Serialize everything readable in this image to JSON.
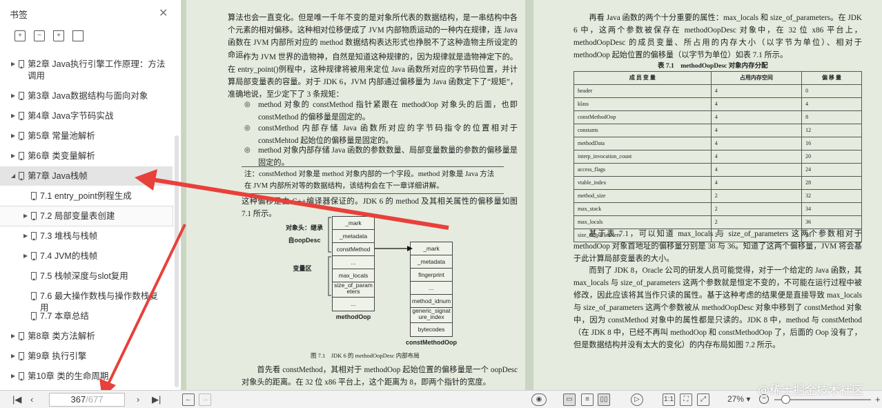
{
  "sidebar": {
    "title": "书签",
    "toolbar_icons": [
      "expand-all-icon",
      "collapse-all-icon",
      "add-bookmark-icon",
      "bookmark-icon"
    ],
    "items": [
      {
        "label": "第2章 Java执行引擎工作原理：方法调用",
        "level": 0,
        "toggle": "▶"
      },
      {
        "label": "第3章 Java数据结构与面向对象",
        "level": 0,
        "toggle": "▶"
      },
      {
        "label": "第4章 Java字节码实战",
        "level": 0,
        "toggle": "▶"
      },
      {
        "label": "第5章 常量池解析",
        "level": 0,
        "toggle": "▶"
      },
      {
        "label": "第6章 类变量解析",
        "level": 0,
        "toggle": "▶"
      },
      {
        "label": "第7章 Java栈帧",
        "level": 0,
        "toggle": "◢"
      },
      {
        "label": "7.1 entry_point例程生成",
        "level": 1,
        "toggle": ""
      },
      {
        "label": "7.2 局部变量表创建",
        "level": 1,
        "toggle": "▶"
      },
      {
        "label": "7.3 堆栈与栈帧",
        "level": 1,
        "toggle": "▶"
      },
      {
        "label": "7.4 JVM的栈帧",
        "level": 1,
        "toggle": "▶"
      },
      {
        "label": "7.5 栈帧深度与slot复用",
        "level": 1,
        "toggle": ""
      },
      {
        "label": "7.6 最大操作数栈与操作数栈复用",
        "level": 1,
        "toggle": ""
      },
      {
        "label": "7.7 本章总结",
        "level": 1,
        "toggle": ""
      },
      {
        "label": "第8章 类方法解析",
        "level": 0,
        "toggle": "▶"
      },
      {
        "label": "第9章 执行引擎",
        "level": 0,
        "toggle": "▶"
      },
      {
        "label": "第10章 类的生命周期",
        "level": 0,
        "toggle": "▶"
      }
    ]
  },
  "page_left": {
    "p1": "算法也会一直变化。但是唯一千年不变的是对象所代表的数据结构，是一串结构中各个元素的相对偏移。这种相对位移便成了 JVM 内部物质运动的一种内在规律，连 Java 函数在 JVM 内部所对应的 method 数据结构表达形式也挣脱不了这种造物主所设定的命运。",
    "p2": "作为 JVM 世界的造物神，自然是知道这种规律的，因为规律就是造物神定下的。在 entry_point()例程中，这种规律将被用来定位 Java 函数所对应的字节码位置，并计算局部变量表的容量。对于 JDK 6，JVM 内部通过偏移量为 Java 函数定下了“规矩”，准确地说，至少定下了 3 条规矩：",
    "b1": "method 对象的 constMethod 指针紧跟在 methodOop 对象头的后面，也即 constMethod 的偏移量是固定的。",
    "b2": "constMethod 内部存储 Java 函数所对应的字节码指令的位置相对于 constMehtod 起始位的偏移量是固定的。",
    "b3": "method 对象内部存储 Java 函数的参数数量、局部变量数量的参数的偏移量是固定的。",
    "note": "注：constMethod 对象是 method 对象内部的一个字段。method 对象是 Java 方法在 JVM 内部所对等的数据结构，该结构会在下一章详细讲解。",
    "p3": "这种偏移是由 C++编译器保证的。JDK 6 的 method 及其相关属性的偏移量如图 7.1 所示。",
    "fig_caption": "图 7.1　JDK 6 的 methodOopDesc 内部布局",
    "p4": "首先看 constMethod，其相对于 methodOop 起始位置的偏移量是一个 oopDesc 对象头的距离。在 32 位 x86 平台上，这个距离为 8，即两个指针的宽度。"
  },
  "figure": {
    "label_header": "对象头：继承自oopDesc",
    "label_vars": "变量区",
    "methodOop_rows": [
      "_mark",
      "_metadata",
      "constMethod",
      "...",
      "max_locals",
      "size_of_parameters",
      "..."
    ],
    "methodOop_title": "methodOop",
    "constMethod_rows": [
      "_mark",
      "_metadata",
      "fingerprint",
      "...",
      "method_idnum",
      "generic_signature_index",
      "bytecodes"
    ],
    "constMethod_title": "constMethodOop"
  },
  "page_right": {
    "p1": "再看 Java 函数的两个十分重要的属性：max_locals 和 size_of_parameters。在 JDK 6 中，这两个参数被保存在 methodOopDesc 对象中，在 32 位 x86 平台上，methodOopDesc 的成员变量、所占用的内存大小（以字节为单位）、相对于 methodOop 起始位置的偏移量（以字节为单位）如表 7.1 所示。",
    "table_title": "表 7.1　methodOopDesc 对象内存分配",
    "table_headers": [
      "成 员 变 量",
      "占用内存空间",
      "偏 移 量"
    ],
    "table_rows": [
      [
        "header",
        "4",
        "0"
      ],
      [
        "klass",
        "4",
        "4"
      ],
      [
        "constMethodOop",
        "4",
        "8"
      ],
      [
        "constants",
        "4",
        "12"
      ],
      [
        "methodData",
        "4",
        "16"
      ],
      [
        "interp_invocation_count",
        "4",
        "20"
      ],
      [
        "access_flags",
        "4",
        "24"
      ],
      [
        "vtable_index",
        "4",
        "28"
      ],
      [
        "method_size",
        "2",
        "32"
      ],
      [
        "max_stack",
        "2",
        "34"
      ],
      [
        "max_locals",
        "2",
        "36"
      ],
      [
        "size_of_parameters",
        "2",
        "38"
      ]
    ],
    "p2": "基于表 7.1，可以知道 max_locals 与 size_of_parameters 这两个参数相对于 methodOop 对象首地址的偏移量分别是 38 与 36。知道了这两个偏移量，JVM 将会基于此计算局部变量表的大小。",
    "p3": "而到了 JDK 8，Oracle 公司的研发人员可能觉得，对于一个给定的 Java 函数，其 max_locals 与 size_of_parameters 这两个参数就是恒定不变的，不可能在运行过程中被修改，因此应该将其当作只读的属性。基于这种考虑的结果便是直接导致 max_locals 与 size_of_parameters 这两个参数被从 methodOopDesc 对象中移到了 constMethod 对象中，因为 constMethod 对象中的属性都是只读的。JDK 8 中，method 与 constMethod（在 JDK 8 中，已经不再叫 methodOop 和 constMethodOop 了，后面的 Oop 没有了，但是数据结构并没有太大的变化）的内存布局如图 7.2 所示。"
  },
  "statusbar": {
    "current_page": "367",
    "total_pages": "/677",
    "zoom": "27%",
    "first_icon": "first-page-icon",
    "prev_icon": "prev-page-icon",
    "next_icon": "next-page-icon",
    "last_icon": "last-page-icon"
  },
  "watermark": "@稀土掘金技术社区",
  "colors": {
    "page_bg": "#e5ebde",
    "doc_bg": "#c9d6c1",
    "arrow": "#e8403a"
  }
}
